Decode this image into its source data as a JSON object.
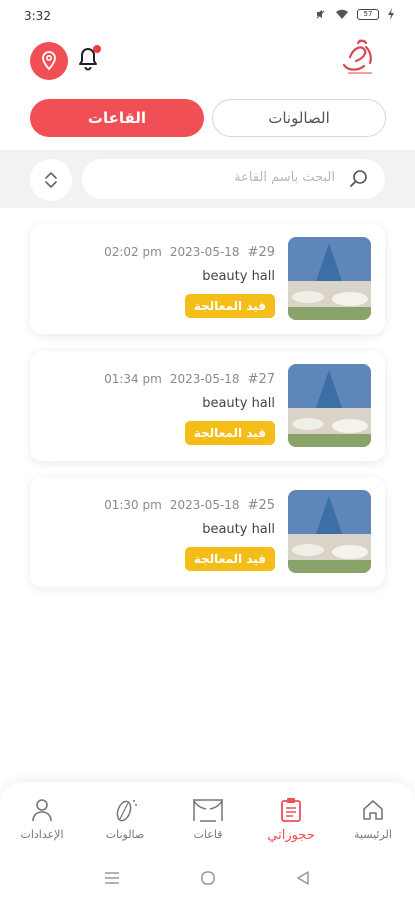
{
  "status_bar": {
    "time": "3:32",
    "battery": "57"
  },
  "header": {
    "location_icon": "location-pin-icon",
    "bell_icon": "bell-icon",
    "logo_icon": "calligraphy-logo-icon"
  },
  "tabs": {
    "halls": "القاعات",
    "salons": "الصالونات"
  },
  "search": {
    "placeholder": "البحث باسم القاعة",
    "icon": "search-icon",
    "sort_icon": "sort-icon"
  },
  "bookings": [
    {
      "number": "#29",
      "date": "2023-05-18",
      "time": "02:02 pm",
      "hall": "beauty hall",
      "status": "قيد المعالجة"
    },
    {
      "number": "#27",
      "date": "2023-05-18",
      "time": "01:34 pm",
      "hall": "beauty hall",
      "status": "قيد المعالجة"
    },
    {
      "number": "#25",
      "date": "2023-05-18",
      "time": "01:30 pm",
      "hall": "beauty hall",
      "status": "قيد المعالجة"
    }
  ],
  "bottom_nav": {
    "home": "الرئيسية",
    "bookings": "حجوزاتي",
    "halls": "قاعات",
    "salons": "صالونات",
    "settings": "الإعدادات"
  },
  "colors": {
    "accent": "#ef4f55",
    "badge": "#f5bd18"
  }
}
